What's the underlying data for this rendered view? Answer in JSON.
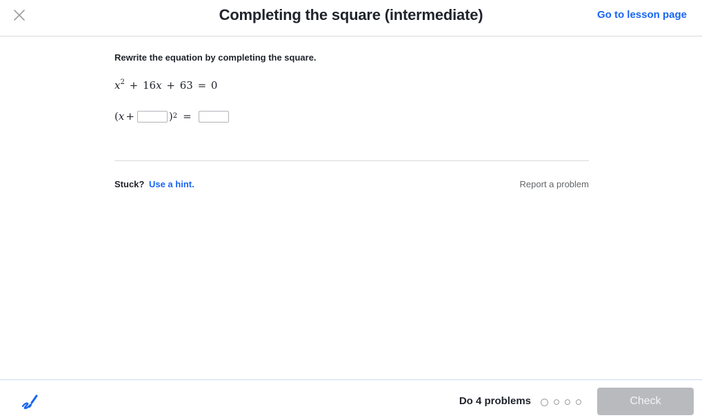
{
  "header": {
    "title": "Completing the square (intermediate)",
    "lesson_link": "Go to lesson page",
    "close_icon": "close-icon"
  },
  "exercise": {
    "prompt": "Rewrite the equation by completing the square.",
    "equation": {
      "x": "x",
      "exp": "2",
      "plus1": "+",
      "coef": "16",
      "x2": "x",
      "plus2": "+",
      "constant": "63",
      "equals": "=",
      "rhs": "0"
    },
    "answer_template": {
      "open": "(",
      "x": "x",
      "plus": "+",
      "close": ")",
      "exp": "2",
      "equals": "=",
      "blank1_value": "",
      "blank2_value": ""
    }
  },
  "help": {
    "stuck_label": "Stuck?",
    "hint_label": "Use a hint.",
    "report_label": "Report a problem"
  },
  "footer": {
    "scratchpad_icon": "pencil-scribble-icon",
    "progress_label": "Do 4 problems",
    "total_problems": 4,
    "current_problem": 1,
    "check_label": "Check",
    "check_color": "#b8babd"
  },
  "colors": {
    "link_blue": "#1865f2",
    "text": "#21242c",
    "muted": "#626569"
  }
}
